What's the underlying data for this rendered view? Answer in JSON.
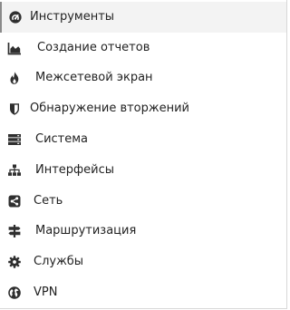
{
  "colors": {
    "text": "#222222",
    "icon": "#2f2f2f",
    "active_background": "#f3f3f3",
    "active_border": "#8a8a8a"
  },
  "menu": {
    "items": [
      {
        "label": "Инструменты",
        "icon": "dashboard-icon",
        "active": true
      },
      {
        "label": "Создание отчетов",
        "icon": "area-chart-icon"
      },
      {
        "label": "Межсетевой экран",
        "icon": "fire-icon"
      },
      {
        "label": "Обнаружение вторжений",
        "icon": "shield-icon"
      },
      {
        "label": "Система",
        "icon": "server-icon"
      },
      {
        "label": "Интерфейсы",
        "icon": "sitemap-icon"
      },
      {
        "label": "Сеть",
        "icon": "share-icon"
      },
      {
        "label": "Маршрутизация",
        "icon": "signpost-icon"
      },
      {
        "label": "Службы",
        "icon": "gear-icon"
      },
      {
        "label": "VPN",
        "icon": "globe-icon"
      }
    ]
  }
}
